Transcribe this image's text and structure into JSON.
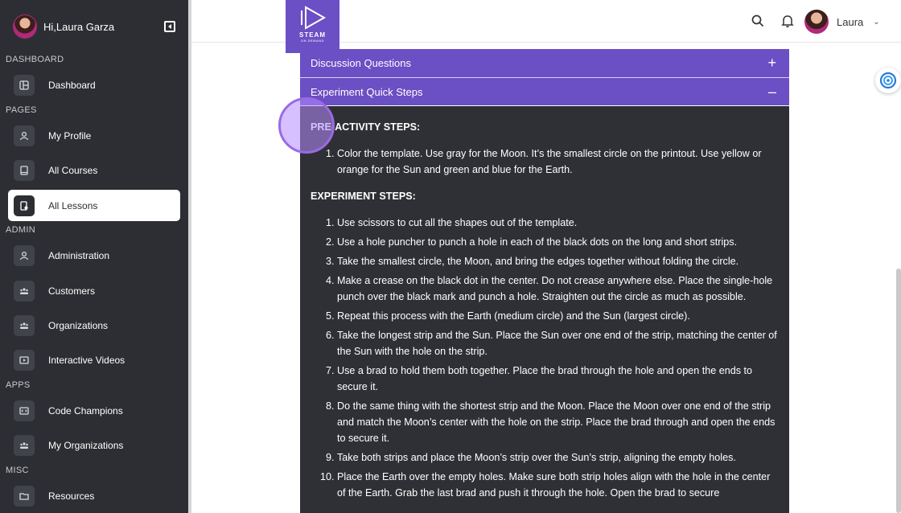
{
  "sidebar": {
    "greeting": "Hi,Laura Garza",
    "sections": {
      "dashboard": "DASHBOARD",
      "pages": "PAGES",
      "admin": "ADMIN",
      "apps": "APPS",
      "misc": "MISC"
    },
    "items": {
      "dashboard": "Dashboard",
      "my_profile": "My Profile",
      "all_courses": "All Courses",
      "all_lessons": "All Lessons",
      "administration": "Administration",
      "customers": "Customers",
      "organizations": "Organizations",
      "interactive_videos": "Interactive Videos",
      "code_champions": "Code Champions",
      "my_organizations": "My Organizations",
      "resources": "Resources"
    },
    "active_item": "All Lessons"
  },
  "header": {
    "logo_text": "STEAM",
    "logo_sub": "ON DEMAND",
    "user_name": "Laura"
  },
  "accordion": {
    "discussion": "Discussion Questions",
    "quick_steps": "Experiment Quick Steps",
    "plus": "+",
    "minus": "–"
  },
  "content": {
    "pre_title": "PRE-ACTIVITY STEPS:",
    "pre_steps": [
      "Color the template. Use gray for the Moon. It’s the smallest circle on the printout. Use yellow or orange for the Sun and green and blue for the Earth."
    ],
    "exp_title": "EXPERIMENT STEPS:",
    "exp_steps": [
      "Use scissors to cut all the shapes out of the template.",
      "Use a hole puncher to punch a hole in each of the black dots on the long and short strips.",
      "Take the smallest circle, the Moon, and bring the edges together without folding the circle.",
      "Make a crease on the black dot in the center. Do not crease anywhere else. Place the single-hole punch over the black mark and punch a hole. Straighten out the circle as much as possible.",
      "Repeat this process with the Earth (medium circle) and the Sun (largest circle).",
      "Take the longest strip and the Sun. Place the Sun over one end of the strip, matching the center of the Sun with the hole on the strip.",
      "Use a brad to hold them both together. Place the brad through the hole and open the ends to secure it.",
      "Do the same thing with the shortest strip and the Moon. Place the Moon over one end of the strip and match the Moon’s center with the hole on the strip. Place the brad through and open the ends to secure it.",
      "Take both strips and place the Moon’s strip over the Sun’s strip, aligning the empty holes.",
      "Place the Earth over the empty holes. Make sure both strip holes align with the hole in the center of the Earth. Grab the last brad and push it through the hole. Open the brad to secure"
    ]
  },
  "colors": {
    "accent": "#6b4fc4",
    "sidebar": "#2d2e33",
    "content_bg": "#2f3036"
  }
}
